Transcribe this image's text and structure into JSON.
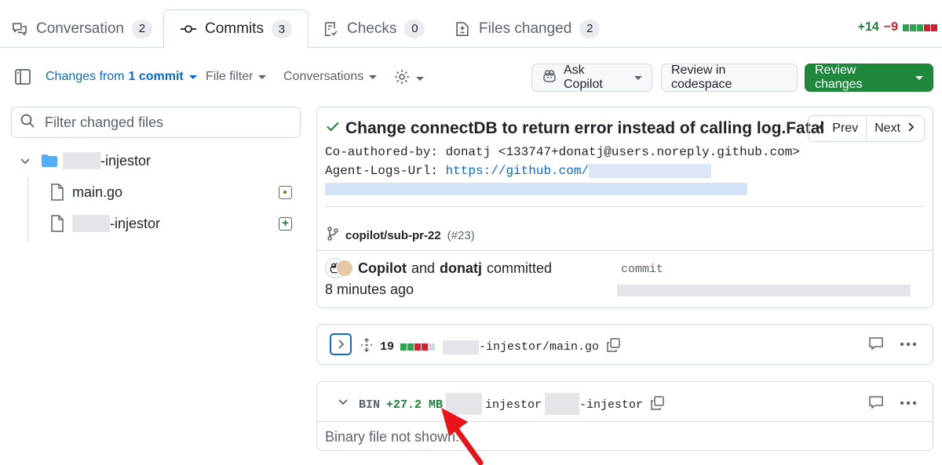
{
  "tabs": [
    {
      "label": "Conversation",
      "count": "2",
      "icon": "comment-discussion-icon"
    },
    {
      "label": "Commits",
      "count": "3",
      "icon": "git-commit-icon",
      "active": true
    },
    {
      "label": "Checks",
      "count": "0",
      "icon": "checklist-icon"
    },
    {
      "label": "Files changed",
      "count": "2",
      "icon": "file-diff-icon"
    }
  ],
  "diffstat": {
    "additions": "+14",
    "deletions": "−9"
  },
  "toolbar": {
    "changes_prefix": "Changes from",
    "changes_count": "1 commit",
    "file_filter": "File filter",
    "conversations": "Conversations",
    "ask_copilot": "Ask Copilot",
    "review_codespace": "Review in codespace",
    "review_changes": "Review changes"
  },
  "sidebar": {
    "filter_placeholder": "Filter changed files",
    "folder_suffix": "-injestor",
    "files": [
      {
        "name": "main.go",
        "status": "modified"
      },
      {
        "name": "-injestor",
        "status": "added"
      }
    ]
  },
  "commit": {
    "title": "Change connectDB to return error instead of calling log.Fatal",
    "prev": "Prev",
    "next": "Next",
    "coauthor_line": "Co-authored-by: donatj <133747+donatj@users.noreply.github.com>",
    "agent_logs_label": "Agent-Logs-Url: ",
    "agent_logs_link": "https://github.com/",
    "branch": "copilot/sub-pr-22",
    "pr_ref": "(#23)",
    "author1": "Copilot",
    "and": "and",
    "author2": "donatj",
    "committed": "committed",
    "time": "8 minutes ago",
    "commit_label": "commit"
  },
  "file_diffs": [
    {
      "lines": "19",
      "path_suffix": "-injestor/main.go"
    },
    {
      "bin_label": "BIN",
      "size": "+27.2 MB",
      "path_mid": "injestor",
      "path_suffix": "-injestor",
      "binary_note": "Binary file not shown."
    }
  ],
  "colors": {
    "accent": "#0969da",
    "primary_button": "#1f883d",
    "annotation_arrow": "#e8141a"
  }
}
